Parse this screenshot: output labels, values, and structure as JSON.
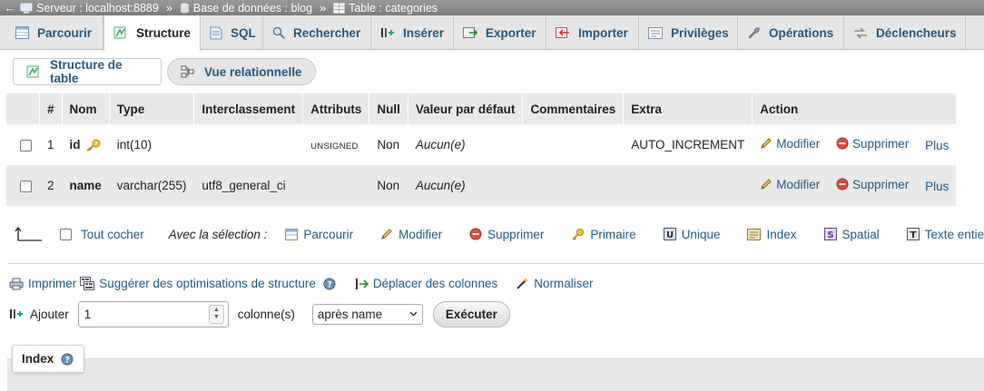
{
  "breadcrumb": {
    "back": "←",
    "server": "Serveur : localhost:8889",
    "database": "Base de données : blog",
    "table": "Table : categories",
    "sep": "»"
  },
  "tabs": [
    {
      "label": "Parcourir",
      "icon": "browse-icon"
    },
    {
      "label": "Structure",
      "icon": "structure-icon"
    },
    {
      "label": "SQL",
      "icon": "sql-icon"
    },
    {
      "label": "Rechercher",
      "icon": "search-icon"
    },
    {
      "label": "Insérer",
      "icon": "insert-icon"
    },
    {
      "label": "Exporter",
      "icon": "export-icon"
    },
    {
      "label": "Importer",
      "icon": "import-icon"
    },
    {
      "label": "Privilèges",
      "icon": "privileges-icon"
    },
    {
      "label": "Opérations",
      "icon": "wrench-icon"
    },
    {
      "label": "Déclencheurs",
      "icon": "triggers-icon"
    }
  ],
  "active_tab": "Structure",
  "subtabs": [
    {
      "label": "Structure de table",
      "icon": "structure-icon"
    },
    {
      "label": "Vue relationnelle",
      "icon": "relation-icon"
    }
  ],
  "table": {
    "headers": [
      "#",
      "Nom",
      "Type",
      "Interclassement",
      "Attributs",
      "Null",
      "Valeur par défaut",
      "Commentaires",
      "Extra",
      "Action"
    ],
    "rows": [
      {
        "num": "1",
        "name": "id",
        "type": "int(10)",
        "collation": "",
        "attributes": "UNSIGNED",
        "null": "Non",
        "default": "Aucun(e)",
        "comments": "",
        "extra": "AUTO_INCREMENT",
        "primary_key": true
      },
      {
        "num": "2",
        "name": "name",
        "type": "varchar(255)",
        "collation": "utf8_general_ci",
        "attributes": "",
        "null": "Non",
        "default": "Aucun(e)",
        "comments": "",
        "extra": "",
        "primary_key": false
      }
    ],
    "actions": {
      "modify": "Modifier",
      "delete": "Supprimer",
      "more": "Plus"
    }
  },
  "selection": {
    "check_all": "Tout cocher",
    "with_selected": "Avec la sélection :",
    "browse": "Parcourir",
    "modify": "Modifier",
    "delete": "Supprimer",
    "primary": "Primaire",
    "unique": "Unique",
    "index": "Index",
    "spatial": "Spatial",
    "fulltext": "Texte entier"
  },
  "tools": {
    "print": "Imprimer",
    "suggest": "Suggérer des optimisations de structure",
    "move_columns": "Déplacer des colonnes",
    "normalize": "Normaliser"
  },
  "add": {
    "label": "Ajouter",
    "value": "1",
    "columns_label": "colonne(s)",
    "position": "après name",
    "execute": "Exécuter"
  },
  "index_section": {
    "title": "Index"
  },
  "colors": {
    "link": "#235a81",
    "header_bg": "#e8e8e8",
    "row_alt": "#e9e9e9",
    "key": "#d8a617",
    "delete": "#d9473a"
  }
}
